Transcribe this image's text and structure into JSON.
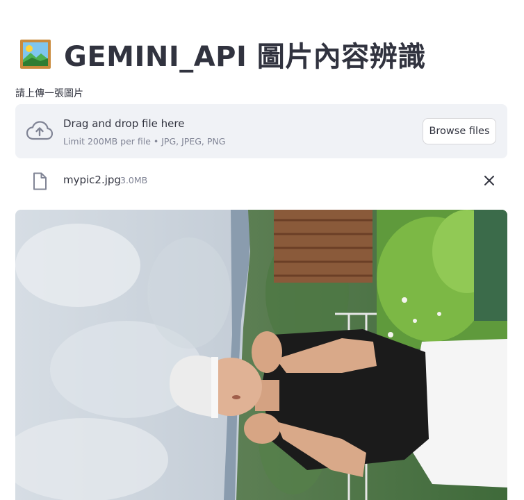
{
  "header": {
    "title": "GEMINI_API 圖片內容辨識",
    "emoji_icon": "framed-picture-icon"
  },
  "uploader": {
    "label": "請上傳一張圖片",
    "drop_text": "Drag and drop file here",
    "limit_text": "Limit 200MB per file • JPG, JPEG, PNG",
    "browse_label": "Browse files",
    "upload_icon": "cloud-upload-icon"
  },
  "file": {
    "name": "mypic2.jpg",
    "size": "3.0MB",
    "file_icon": "file-icon",
    "remove_icon": "close-icon"
  },
  "colors": {
    "text": "#31333f",
    "muted": "#808495",
    "dropzone_bg": "#f0f2f6",
    "border": "#d6d6d9"
  }
}
